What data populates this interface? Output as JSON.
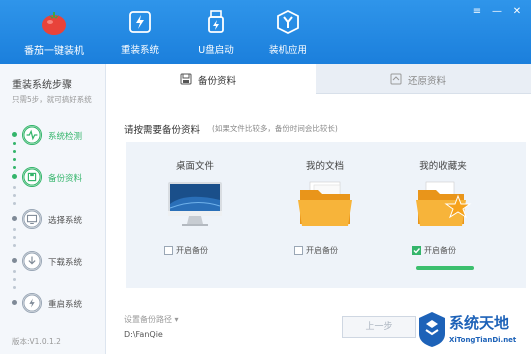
{
  "header": {
    "app_name": "番茄一键装机",
    "nav": [
      {
        "label": "重装系统",
        "icon": "lightning-icon"
      },
      {
        "label": "U盘启动",
        "icon": "usb-icon"
      },
      {
        "label": "装机应用",
        "icon": "y-shield-icon"
      }
    ],
    "window_controls": [
      "≡",
      "—",
      "✕"
    ]
  },
  "sidebar": {
    "title": "重装系统步骤",
    "subtitle": "只需5步，就可搞好系统",
    "steps": [
      {
        "label": "系统检测",
        "icon": "pulse-icon",
        "state": "done"
      },
      {
        "label": "备份资料",
        "icon": "backup-icon",
        "state": "current"
      },
      {
        "label": "选择系统",
        "icon": "monitor-icon",
        "state": "pending"
      },
      {
        "label": "下载系统",
        "icon": "download-icon",
        "state": "pending"
      },
      {
        "label": "重启系统",
        "icon": "restart-icon",
        "state": "pending"
      }
    ],
    "version": "版本:V1.0.1.2"
  },
  "tabs": [
    {
      "label": "备份资料",
      "icon": "backup-tab-icon",
      "active": true
    },
    {
      "label": "还原资料",
      "icon": "restore-tab-icon",
      "active": false
    }
  ],
  "main": {
    "title": "请按需要备份资料",
    "hint": "(如果文件比较多，备份时间会比较长)",
    "cards": [
      {
        "title": "桌面文件",
        "checkbox_label": "开启备份",
        "checked": false
      },
      {
        "title": "我的文档",
        "checkbox_label": "开启备份",
        "checked": false
      },
      {
        "title": "我的收藏夹",
        "checkbox_label": "开启备份",
        "checked": true
      }
    ],
    "favorites_progress": 1.0,
    "path_label": "设置备份路径 ▾",
    "path_value": "D:\\FanQie",
    "prev_button": "上一步"
  },
  "watermark": {
    "title": "系统天地",
    "url": "XiTongTianDi.net"
  },
  "colors": {
    "header_blue": "#1e86e4",
    "accent_green": "#34b56b",
    "folder_orange": "#f5a623",
    "watermark_blue": "#1d62b8"
  }
}
